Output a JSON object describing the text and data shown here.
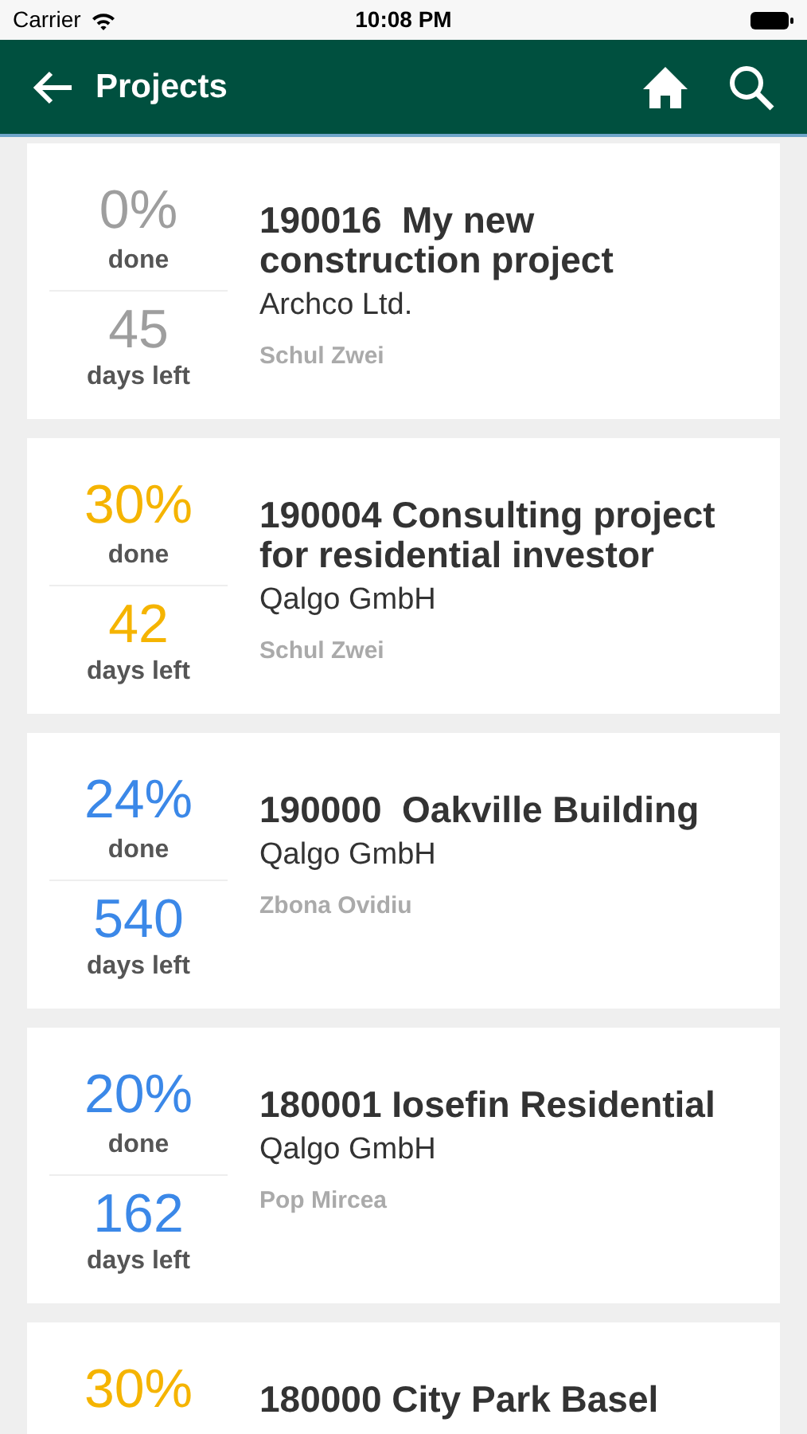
{
  "status_bar": {
    "carrier": "Carrier",
    "time": "10:08 PM"
  },
  "header": {
    "title": "Projects"
  },
  "projects": [
    {
      "percent": "0%",
      "done_label": "done",
      "days": "45",
      "days_label": "days left",
      "color": "#9e9e9e",
      "title": "190016  My new construction project",
      "company": "Archco Ltd.",
      "manager": "Schul Zwei"
    },
    {
      "percent": "30%",
      "done_label": "done",
      "days": "42",
      "days_label": "days left",
      "color": "#f5b400",
      "title": "190004 Consulting project for residential investor",
      "company": "Qalgo GmbH",
      "manager": "Schul Zwei"
    },
    {
      "percent": "24%",
      "done_label": "done",
      "days": "540",
      "days_label": "days left",
      "color": "#3b88e8",
      "title": "190000  Oakville Building",
      "company": "Qalgo GmbH",
      "manager": "Zbona Ovidiu"
    },
    {
      "percent": "20%",
      "done_label": "done",
      "days": "162",
      "days_label": "days left",
      "color": "#3b88e8",
      "title": "180001 Iosefin Residential",
      "company": "Qalgo GmbH",
      "manager": "Pop Mircea"
    },
    {
      "percent": "30%",
      "color": "#f5b400",
      "title": "180000 City Park Basel"
    }
  ]
}
